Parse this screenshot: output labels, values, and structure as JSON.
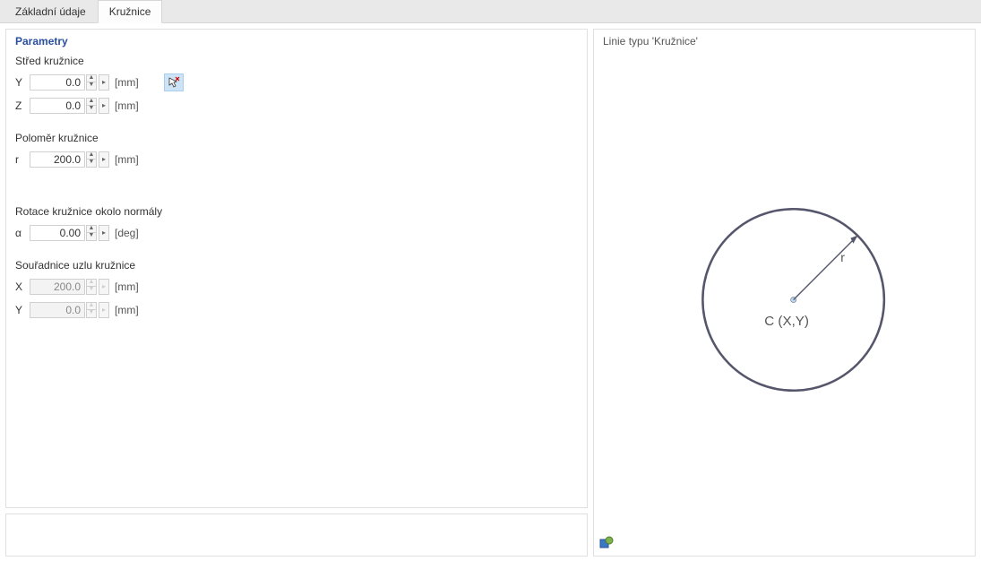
{
  "tabs": {
    "basic": "Základní údaje",
    "circle": "Kružnice",
    "active_index": 1
  },
  "section_title": "Parametry",
  "groups": {
    "center": {
      "label": "Střed kružnice",
      "y": {
        "label": "Y",
        "value": "0.0",
        "unit": "[mm]"
      },
      "z": {
        "label": "Z",
        "value": "0.0",
        "unit": "[mm]"
      }
    },
    "radius": {
      "label": "Poloměr kružnice",
      "r": {
        "label": "r",
        "value": "200.0",
        "unit": "[mm]"
      }
    },
    "rotation": {
      "label": "Rotace kružnice okolo normály",
      "alpha": {
        "label": "α",
        "value": "0.00",
        "unit": "[deg]"
      }
    },
    "node": {
      "label": "Souřadnice uzlu kružnice",
      "x": {
        "label": "X",
        "value": "200.0",
        "unit": "[mm]"
      },
      "y": {
        "label": "Y",
        "value": "0.0",
        "unit": "[mm]"
      }
    }
  },
  "preview": {
    "title": "Linie typu 'Kružnice'",
    "center_label": "C (X,Y)",
    "radius_label": "r"
  },
  "icons": {
    "pick_point": "pick-point-icon",
    "corner": "preview-settings-icon"
  },
  "chart_data": {
    "type": "circle-diagram",
    "center": "C (X,Y)",
    "radius_label": "r",
    "radius_px": 100
  }
}
